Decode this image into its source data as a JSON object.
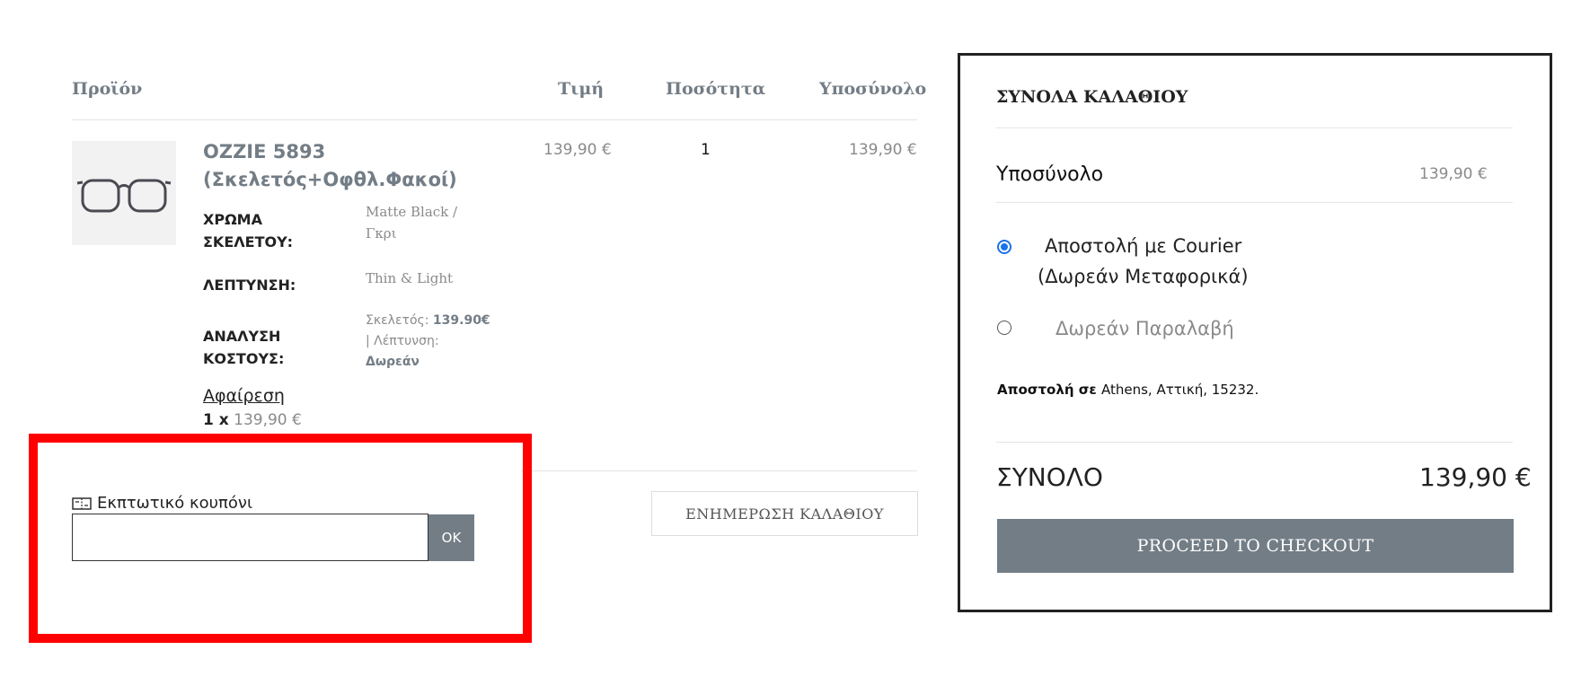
{
  "cart_table": {
    "headers": {
      "product": "Προϊόν",
      "price": "Τιμή",
      "quantity": "Ποσότητα",
      "subtotal": "Υποσύνολο"
    }
  },
  "item": {
    "title_line1": "OZZIE 5893",
    "title_line2": "(Σκελετός+Οφθλ.Φακοί)",
    "price": "139,90 €",
    "quantity": "1",
    "subtotal": "139,90 €",
    "meta": {
      "color_label_1": "ΧΡΩΜΑ",
      "color_label_2": "ΣΚΕΛΕΤΟΥ:",
      "color_value_1": "Matte Black /",
      "color_value_2": "Γκρι",
      "thinning_label": "ΛΕΠΤΥΝΣΗ:",
      "thinning_value": "Thin & Light",
      "cost_label_1": "ΑΝΑΛΥΣΗ",
      "cost_label_2": "ΚΟΣΤΟΥΣ:",
      "cost_frame_prefix": "Σκελετός: ",
      "cost_frame_value": "139.90€",
      "cost_thin_prefix": "| Λέπτυνση:",
      "cost_thin_value": "Δωρεάν"
    },
    "remove_label": "Αφαίρεση",
    "unit_qty": "1 x",
    "unit_price": "139,90 €"
  },
  "coupon": {
    "label": "Εκπτωτικό κουπόνι",
    "value": "",
    "ok_label": "OK"
  },
  "update_cart_label": "ΕΝΗΜΕΡΩΣΗ ΚΑΛΑΘΙΟΥ",
  "totals": {
    "title": "ΣΥΝΟΛΑ ΚΑΛΑΘΙΟΥ",
    "subtotal_label": "Υποσύνολο",
    "subtotal_value": "139,90 €",
    "shipping_options": [
      {
        "line1": "Αποστολή με Courier",
        "line2": "(Δωρεάν Μεταφορικά)",
        "selected": true
      },
      {
        "line1": "Δωρεάν Παραλαβή",
        "selected": false
      }
    ],
    "ship_dest_prefix": "Αποστολή σε ",
    "ship_dest_value": "Athens, Αττική, 15232.",
    "grand_label": "ΣΥΝΟΛΟ",
    "grand_value": "139,90 €",
    "checkout_label": "PROCEED TO CHECKOUT"
  },
  "colors": {
    "accent_gray": "#737d86",
    "highlight": "#ff0000",
    "radio_blue": "#1a73e8"
  }
}
